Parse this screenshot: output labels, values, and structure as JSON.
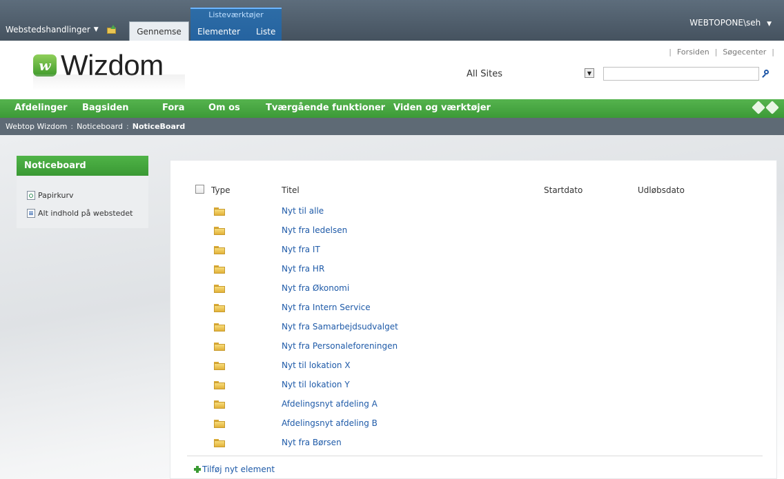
{
  "ribbon": {
    "site_actions": "Webstedshandlinger",
    "tab_browse": "Gennemse",
    "tool_group": "Listeværktøjer",
    "tab_items": "Elementer",
    "tab_list": "Liste",
    "user": "WEBTOPONE\\seh"
  },
  "header": {
    "logo_mark": "w",
    "logo_text": "Wizdom",
    "top_links": [
      "Forsiden",
      "Søgecenter"
    ],
    "scope_value": "All Sites",
    "search_placeholder": ""
  },
  "topnav": [
    "Afdelinger",
    "Bagsiden",
    "Fora",
    "Om os",
    "Tværgående funktioner",
    "Viden og værktøjer"
  ],
  "breadcrumb": {
    "items": [
      "Webtop Wizdom",
      "Noticeboard"
    ],
    "current": "NoticeBoard",
    "separator": ":"
  },
  "leftnav": {
    "title": "Noticeboard",
    "recycle": "Papirkurv",
    "all_content": "Alt indhold på webstedet"
  },
  "list": {
    "headers": {
      "type": "Type",
      "title": "Titel",
      "start": "Startdato",
      "expiry": "Udløbsdato"
    },
    "rows": [
      "Nyt til alle",
      "Nyt fra ledelsen",
      "Nyt fra IT",
      "Nyt fra HR",
      "Nyt fra Økonomi",
      "Nyt fra Intern Service",
      "Nyt fra Samarbejdsudvalget",
      "Nyt fra Personaleforeningen",
      "Nyt til lokation X",
      "Nyt til lokation Y",
      "Afdelingsnyt afdeling A",
      "Afdelingsnyt afdeling B",
      "Nyt fra Børsen"
    ],
    "add_item": "Tilføj nyt element"
  }
}
